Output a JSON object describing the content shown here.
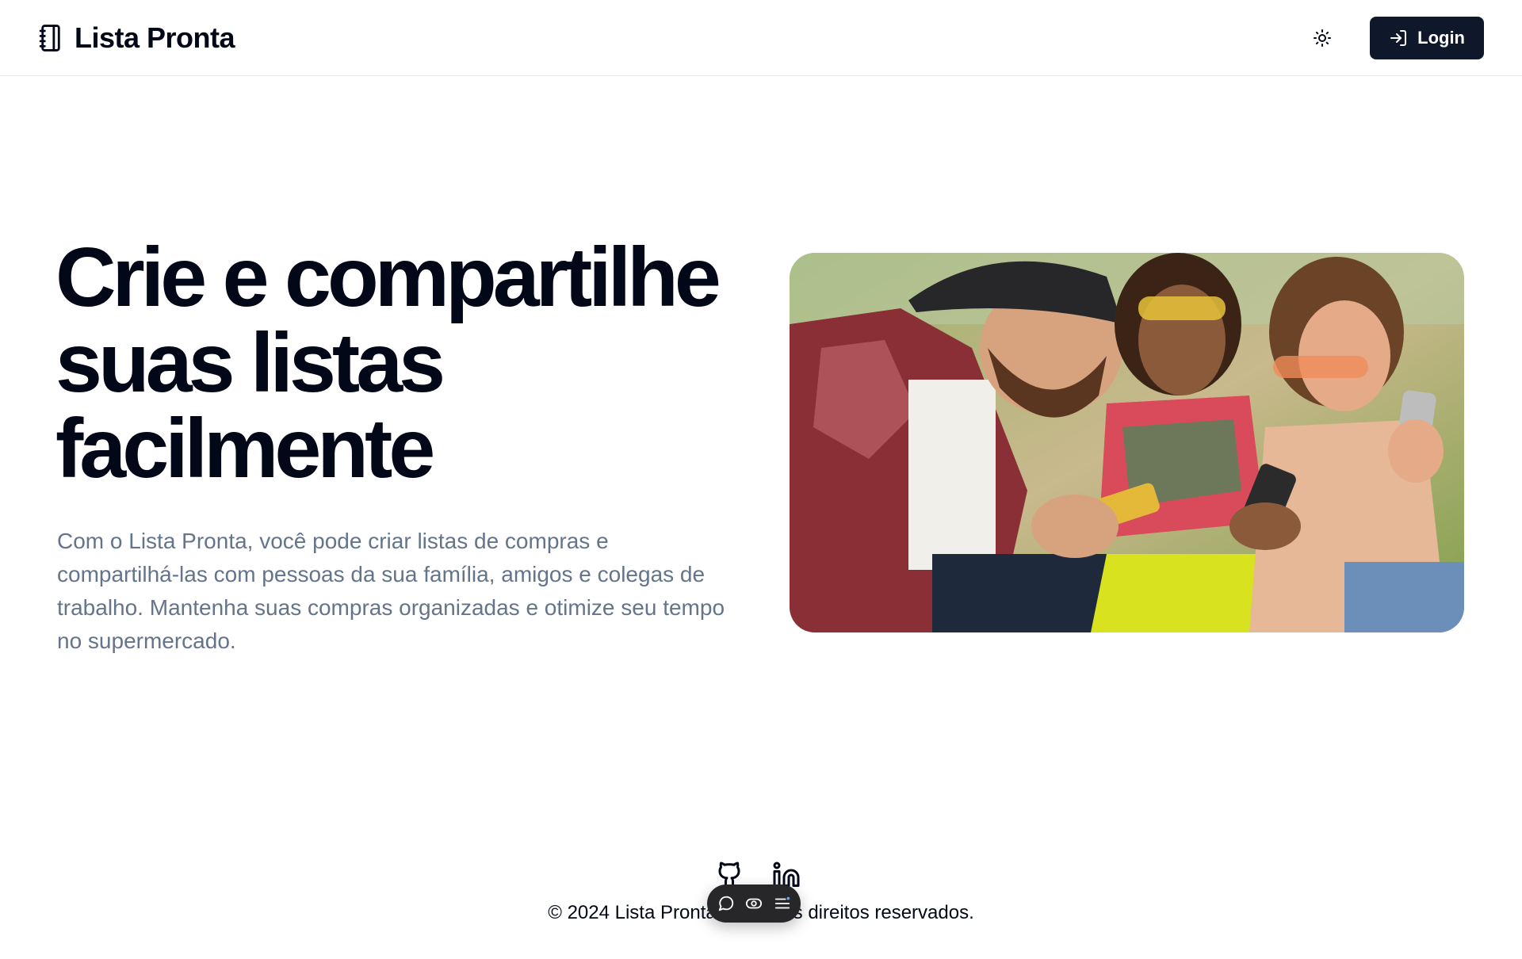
{
  "header": {
    "brand_name": "Lista Pronta",
    "brand_icon": "notebook-icon",
    "theme_icon": "sun-icon",
    "login_label": "Login",
    "login_icon": "log-in-icon"
  },
  "hero": {
    "title": "Crie e compartilhe suas listas facilmente",
    "description": "Com o Lista Pronta, você pode criar listas de compras e compartilhá-las com pessoas da sua família, amigos e colegas de trabalho. Mantenha suas compras organizadas e otimize seu tempo no supermercado.",
    "image": "friends-using-smartphones-photo"
  },
  "footer": {
    "social_icons": [
      "github-icon",
      "linkedin-icon"
    ],
    "copyright": "© 2024 Lista Pronta. Todos os direitos reservados."
  },
  "dock": {
    "icons": [
      "chat-bubble-icon",
      "toggle-eye-icon",
      "menu-lines-icon"
    ]
  },
  "colors": {
    "primary": "#0f172a",
    "text": "#020817",
    "muted": "#64748b",
    "border": "#e5e7eb"
  }
}
